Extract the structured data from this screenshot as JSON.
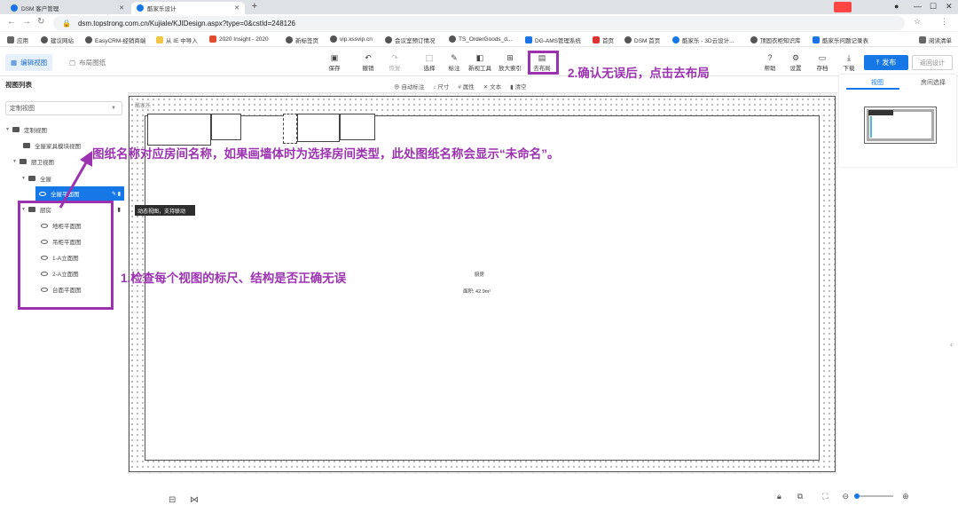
{
  "browser": {
    "tabs": [
      {
        "title": "DSM 客户管理"
      },
      {
        "title": "酷家乐设计"
      }
    ],
    "url": "dsm.topstrong.com.cn/Kujiale/KJIDesign.aspx?type=0&cstId=248126",
    "bookmarks": [
      "应用",
      "建议网站",
      "EasyCRM-经销商端",
      "从 IE 中导入",
      "2020 Insight - 2020",
      "新标签页",
      "vip.xssvip.cn",
      "会议室预订情况",
      "TS_OrderGoods_d...",
      "DG-AMS管理系统",
      "首页",
      "DSM 首页",
      "酷家乐 - 3D云设计...",
      "顶固衣柜知识库",
      "酷家乐问题记录表"
    ],
    "reading_list": "阅读清单"
  },
  "toolbar": {
    "view_tabs": [
      "编辑视图",
      "布局图纸"
    ],
    "left_tools": [
      "保存",
      "撤销",
      "恢复",
      "选择",
      "标注",
      "新视工具",
      "放大索引",
      "去布局"
    ],
    "right_tools": [
      "帮助",
      "设置",
      "存档",
      "下载"
    ],
    "publish": "发布",
    "back": "返回设计"
  },
  "subbar": [
    "自动标注",
    "尺寸",
    "属性",
    "文本",
    "清空"
  ],
  "sidebar": {
    "title": "视图列表",
    "select_value": "定制视图",
    "tree": [
      {
        "label": "定制视图"
      },
      {
        "label": "全屋家具模块视图"
      },
      {
        "label": "厨卫视图"
      },
      {
        "label": "全屋"
      },
      {
        "label": "全屋平面图"
      },
      {
        "label": "厨房"
      },
      {
        "label": "地柜平面图"
      },
      {
        "label": "吊柜平面图"
      },
      {
        "label": "1-A立面图"
      },
      {
        "label": "2-A立面图"
      },
      {
        "label": "台面平面图"
      }
    ],
    "tooltip": "动态视图，支持联动"
  },
  "canvas": {
    "room_name": "厨房",
    "room_area": "面积: 42.9m²",
    "logo": "酷家乐"
  },
  "preview": {
    "tabs": [
      "视图",
      "房间选择"
    ]
  },
  "annotations": {
    "a1": "1.检查每个视图的标尺、结构是否正确无误",
    "a2": "2.确认无误后，点击去布局",
    "a3": "图纸名称对应房间名称，如果画墙体时为选择房间类型，此处图纸名称会显示“未命名”。"
  },
  "colors": {
    "accent": "#1677e6",
    "annotation": "#9b33b0"
  }
}
